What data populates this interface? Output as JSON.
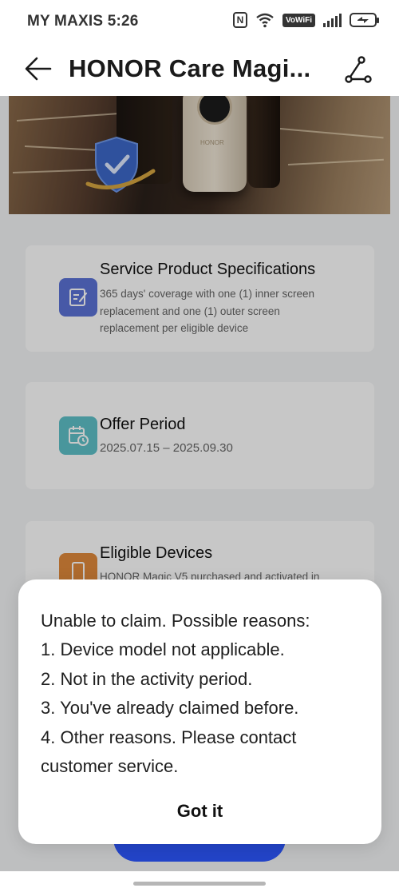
{
  "status_bar": {
    "carrier": "MY MAXIS",
    "time": "5:26",
    "nfc_label": "N",
    "vowifi_label": "VoWiFi"
  },
  "nav": {
    "title": "HONOR Care Magi..."
  },
  "hero": {
    "brand_text": "HONOR"
  },
  "cards": [
    {
      "title": "Service Product Specifications",
      "description": "365 days' coverage with one (1) inner screen replacement and one (1) outer screen replacement per eligible device",
      "icon": "document-edit-icon",
      "icon_color": "#5b72d6"
    },
    {
      "title": "Offer Period",
      "description": "2025.07.15 – 2025.09.30",
      "icon": "calendar-clock-icon",
      "icon_color": "#5ec0c8"
    },
    {
      "title": "Eligible Devices",
      "description": "HONOR Magic V5 purchased and activated in",
      "icon": "phone-icon",
      "icon_color": "#e08a3c"
    }
  ],
  "dialog": {
    "message_lines": [
      "Unable to claim. Possible reasons:",
      "1. Device model not applicable.",
      "2. Not in the activity period.",
      "3. You've already claimed before.",
      "4. Other reasons. Please contact",
      "customer service."
    ],
    "button_label": "Got it"
  },
  "colors": {
    "primary_button": "#2344c8",
    "overlay": "rgba(0,0,0,0.22)"
  }
}
